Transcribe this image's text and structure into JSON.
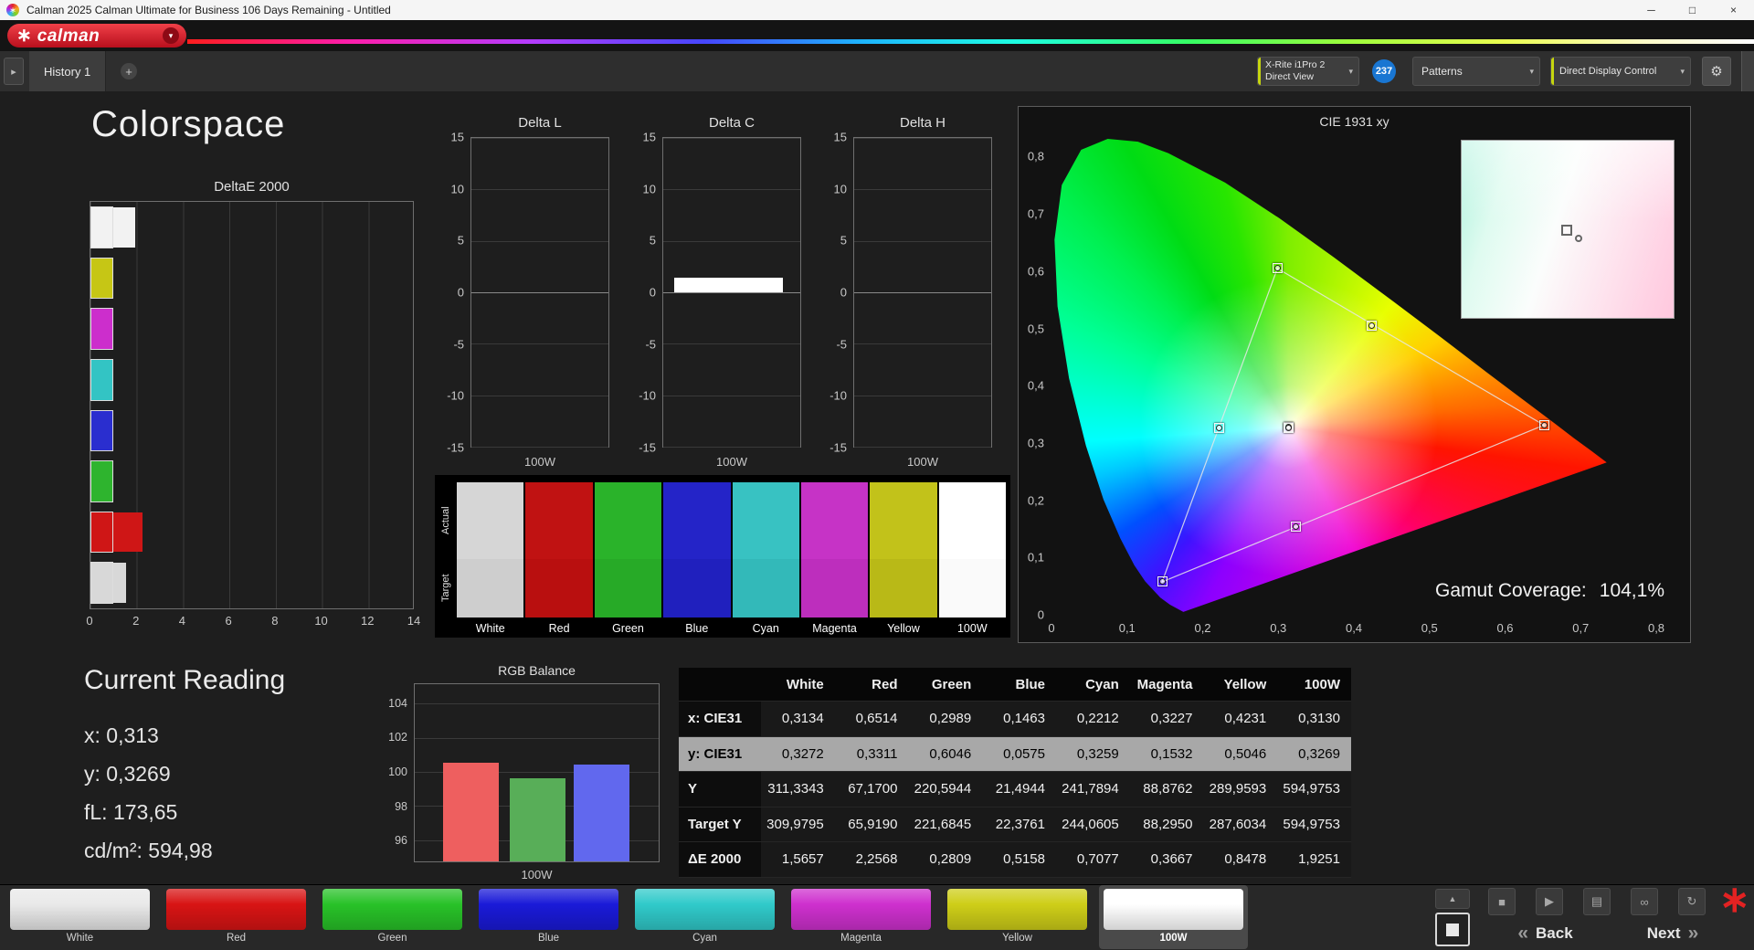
{
  "titlebar": {
    "title": "Calman 2025 Calman Ultimate for Business 106 Days Remaining  - Untitled"
  },
  "brand": {
    "logo_text": "calman"
  },
  "toolbar": {
    "tab": "History 1",
    "meter": {
      "line1": "X-Rite i1Pro 2",
      "line2": "Direct View"
    },
    "badge": "237",
    "patterns_label": "Patterns",
    "display_control_label": "Direct Display Control"
  },
  "page": {
    "title": "Colorspace"
  },
  "current_reading": {
    "title": "Current Reading",
    "lines": [
      "x: 0,313",
      "y: 0,3269",
      "fL: 173,65",
      "cd/m²: 594,98"
    ]
  },
  "gamut_coverage": {
    "label": "Gamut Coverage:",
    "value": "104,1%"
  },
  "chart_data": [
    {
      "id": "deltaE2000",
      "type": "bar",
      "orientation": "horizontal",
      "title": "DeltaE 2000",
      "categories": [
        "100W",
        "Yellow",
        "Magenta",
        "Cyan",
        "Blue",
        "Green",
        "Red",
        "White"
      ],
      "values": [
        1.9251,
        0.8478,
        0.3667,
        0.7077,
        0.5158,
        0.2809,
        2.2568,
        1.5657
      ],
      "colors": [
        "#f2f2f2",
        "#c6c615",
        "#cc2ecc",
        "#33c4c4",
        "#2a2ecf",
        "#2eb42e",
        "#cf1616",
        "#d8d8d8"
      ],
      "xlim": [
        0,
        14
      ],
      "xticks": [
        0,
        2,
        4,
        6,
        8,
        10,
        12,
        14
      ],
      "grid": true
    },
    {
      "id": "deltaL",
      "type": "bar",
      "title": "Delta L",
      "categories": [
        "100W"
      ],
      "values": [
        0
      ],
      "ylim": [
        -15,
        15
      ],
      "yticks": [
        15,
        10,
        5,
        0,
        -5,
        -10,
        -15
      ],
      "xlabel": "100W",
      "bar_color": "#ffffff"
    },
    {
      "id": "deltaC",
      "type": "bar",
      "title": "Delta C",
      "categories": [
        "100W"
      ],
      "values": [
        1.4
      ],
      "ylim": [
        -15,
        15
      ],
      "yticks": [
        15,
        10,
        5,
        0,
        -5,
        -10,
        -15
      ],
      "xlabel": "100W",
      "bar_color": "#ffffff"
    },
    {
      "id": "deltaH",
      "type": "bar",
      "title": "Delta H",
      "categories": [
        "100W"
      ],
      "values": [
        0
      ],
      "ylim": [
        -15,
        15
      ],
      "yticks": [
        15,
        10,
        5,
        0,
        -5,
        -10,
        -15
      ],
      "xlabel": "100W",
      "bar_color": "#ffffff"
    },
    {
      "id": "rgbBalance",
      "type": "bar",
      "title": "RGB Balance",
      "categories": [
        "Red",
        "Green",
        "Blue"
      ],
      "values": [
        100.55,
        99.65,
        100.45
      ],
      "colors": [
        "#ee5f5f",
        "#58ae58",
        "#6168ee"
      ],
      "ylim": [
        94.75,
        105.15
      ],
      "yticks": [
        104,
        102,
        100,
        98,
        96
      ],
      "xlabel": "100W"
    },
    {
      "id": "cie",
      "type": "scatter",
      "title": "CIE 1931 xy",
      "xlim": [
        0,
        0.8
      ],
      "ylim": [
        0,
        0.831
      ],
      "xlabel_ticks": [
        "0",
        "0,1",
        "0,2",
        "0,3",
        "0,4",
        "0,5",
        "0,6",
        "0,7",
        "0,8"
      ],
      "ylabel_ticks": [
        "0,8",
        "0,7",
        "0,6",
        "0,5",
        "0,4",
        "0,3",
        "0,2",
        "0,1",
        "0"
      ],
      "points": [
        {
          "name": "White",
          "x": 0.3134,
          "y": 0.3272
        },
        {
          "name": "Red",
          "x": 0.6514,
          "y": 0.3311
        },
        {
          "name": "Green",
          "x": 0.2989,
          "y": 0.6046
        },
        {
          "name": "Blue",
          "x": 0.1463,
          "y": 0.0575
        },
        {
          "name": "Cyan",
          "x": 0.2212,
          "y": 0.3259
        },
        {
          "name": "Magenta",
          "x": 0.3227,
          "y": 0.1532
        },
        {
          "name": "Yellow",
          "x": 0.4231,
          "y": 0.5046
        },
        {
          "name": "100W",
          "x": 0.313,
          "y": 0.3269
        }
      ],
      "triangle": [
        [
          0.6514,
          0.3311
        ],
        [
          0.2989,
          0.6046
        ],
        [
          0.1463,
          0.0575
        ]
      ]
    }
  ],
  "swatch_panel": {
    "row_labels": [
      "Actual",
      "Target"
    ],
    "columns": [
      {
        "label": "White",
        "actual": "#d6d6d6",
        "target": "#cecece"
      },
      {
        "label": "Red",
        "actual": "#c01212",
        "target": "#b90f0f"
      },
      {
        "label": "Green",
        "actual": "#2ab32a",
        "target": "#27aa27"
      },
      {
        "label": "Blue",
        "actual": "#2424c8",
        "target": "#2020be"
      },
      {
        "label": "Cyan",
        "actual": "#38c2c2",
        "target": "#33b9b9"
      },
      {
        "label": "Magenta",
        "actual": "#c633c6",
        "target": "#bd2ebd"
      },
      {
        "label": "Yellow",
        "actual": "#c2c21a",
        "target": "#b9b917"
      },
      {
        "label": "100W",
        "actual": "#ffffff",
        "target": "#fafafa"
      }
    ]
  },
  "table": {
    "columns": [
      "White",
      "Red",
      "Green",
      "Blue",
      "Cyan",
      "Magenta",
      "Yellow",
      "100W"
    ],
    "rows": [
      {
        "label": "x: CIE31",
        "selected": false,
        "values": [
          "0,3134",
          "0,6514",
          "0,2989",
          "0,1463",
          "0,2212",
          "0,3227",
          "0,4231",
          "0,3130"
        ]
      },
      {
        "label": "y: CIE31",
        "selected": true,
        "values": [
          "0,3272",
          "0,3311",
          "0,6046",
          "0,0575",
          "0,3259",
          "0,1532",
          "0,5046",
          "0,3269"
        ]
      },
      {
        "label": "Y",
        "selected": false,
        "values": [
          "311,3343",
          "67,1700",
          "220,5944",
          "21,4944",
          "241,7894",
          "88,8762",
          "289,9593",
          "594,9753"
        ]
      },
      {
        "label": "Target Y",
        "selected": false,
        "values": [
          "309,9795",
          "65,9190",
          "221,6845",
          "22,3761",
          "244,0605",
          "88,2950",
          "287,6034",
          "594,9753"
        ]
      },
      {
        "label": "ΔE 2000",
        "selected": false,
        "values": [
          "1,5657",
          "2,2568",
          "0,2809",
          "0,5158",
          "0,7077",
          "0,3667",
          "0,8478",
          "1,9251"
        ]
      }
    ]
  },
  "bottom": {
    "swatches": [
      {
        "label": "White",
        "color": "#e9e9e9",
        "selected": false
      },
      {
        "label": "Red",
        "color": "#d81414",
        "selected": false
      },
      {
        "label": "Green",
        "color": "#28c228",
        "selected": false
      },
      {
        "label": "Blue",
        "color": "#1a1ad8",
        "selected": false
      },
      {
        "label": "Cyan",
        "color": "#30caca",
        "selected": false
      },
      {
        "label": "Magenta",
        "color": "#ce30ce",
        "selected": false
      },
      {
        "label": "Yellow",
        "color": "#cece18",
        "selected": false
      },
      {
        "label": "100W",
        "color": "#ffffff",
        "selected": true
      }
    ],
    "back_label": "Back",
    "next_label": "Next"
  },
  "icons": {
    "logo_star": "∗",
    "caret": "▾",
    "expander": "▸",
    "plus": "+",
    "gear": "⚙",
    "minimize": "─",
    "maximize": "□",
    "close": "×",
    "collapse_up": "▲",
    "stop": "■",
    "play": "▶",
    "save": "▤",
    "link": "∞",
    "refresh": "↻",
    "back_chevrons": "«",
    "next_chevrons": "»",
    "asterisk": "∗"
  }
}
